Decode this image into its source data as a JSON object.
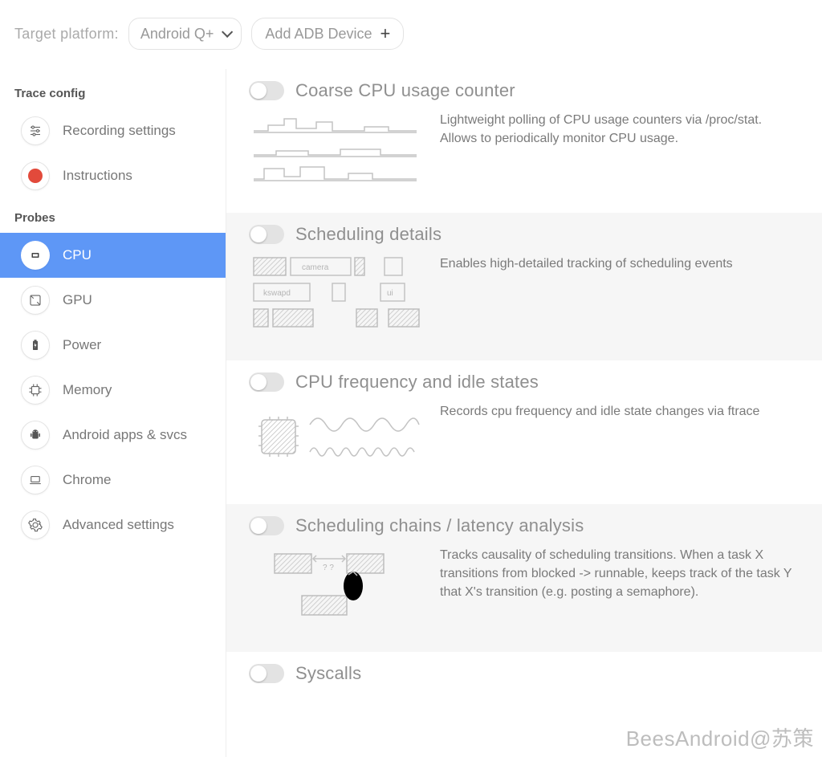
{
  "topbar": {
    "target_label": "Target platform:",
    "platform_selected": "Android Q+",
    "adb_label": "Add ADB Device"
  },
  "sidebar": {
    "sections": {
      "trace_config": {
        "title": "Trace config",
        "items": [
          {
            "label": "Recording settings"
          },
          {
            "label": "Instructions"
          }
        ]
      },
      "probes": {
        "title": "Probes",
        "items": [
          {
            "label": "CPU",
            "active": true
          },
          {
            "label": "GPU"
          },
          {
            "label": "Power"
          },
          {
            "label": "Memory"
          },
          {
            "label": "Android apps & svcs"
          },
          {
            "label": "Chrome"
          },
          {
            "label": "Advanced settings"
          }
        ]
      }
    }
  },
  "probes_detail": [
    {
      "title": "Coarse CPU usage counter",
      "desc": "Lightweight polling of CPU usage counters via /proc/stat. Allows to periodically monitor CPU usage."
    },
    {
      "title": "Scheduling details",
      "desc": "Enables high-detailed tracking of scheduling events"
    },
    {
      "title": "CPU frequency and idle states",
      "desc": "Records cpu frequency and idle state changes via ftrace"
    },
    {
      "title": "Scheduling chains / latency analysis",
      "desc": "Tracks causality of scheduling transitions. When a task X transitions from blocked -> runnable, keeps track of the task Y that X's transition (e.g. posting a semaphore)."
    },
    {
      "title": "Syscalls",
      "desc": ""
    }
  ],
  "watermark": "BeesAndroid@苏策"
}
